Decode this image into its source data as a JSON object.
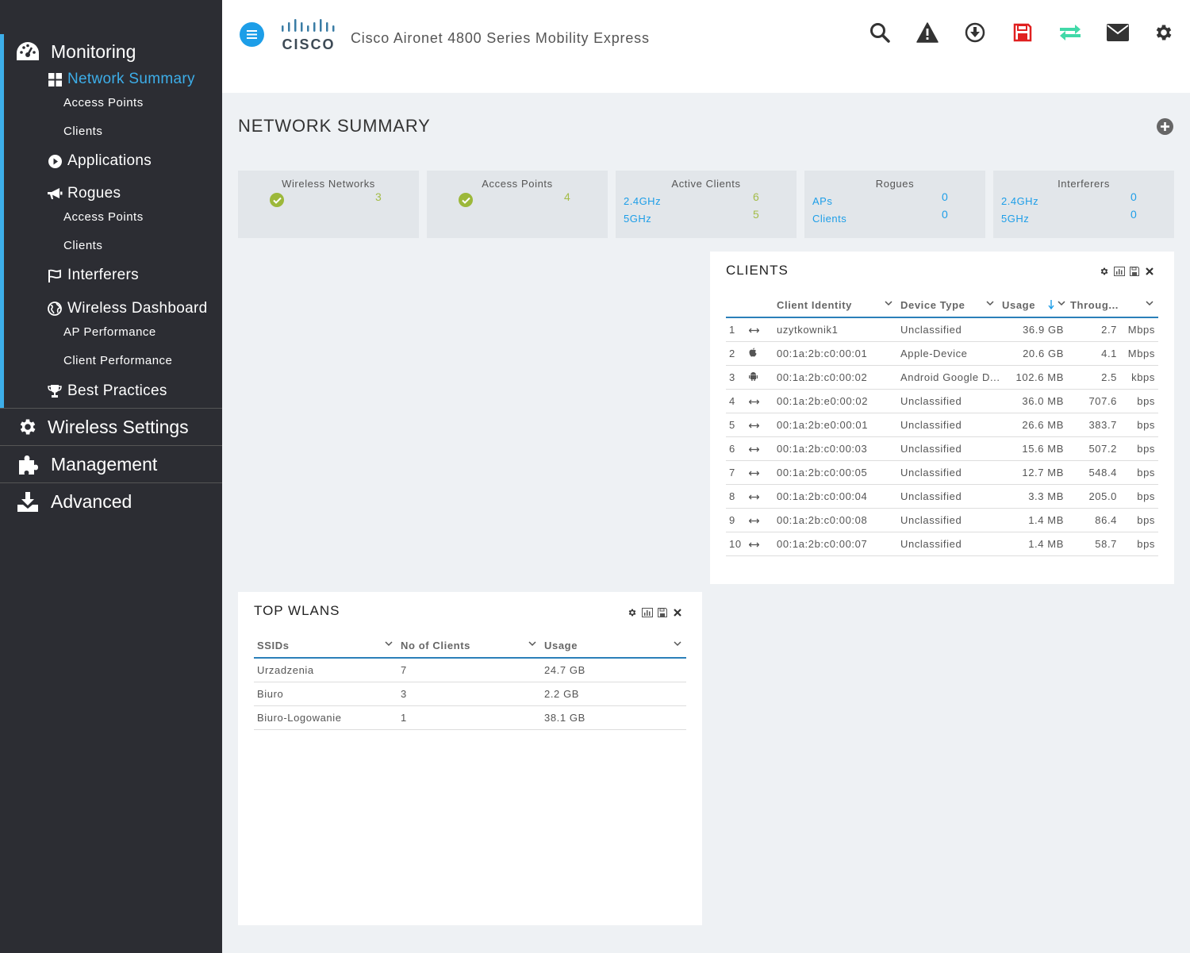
{
  "app": {
    "title": "Cisco Aironet 4800 Series Mobility Express",
    "logo_text": "CISCO"
  },
  "colors": {
    "accent_blue": "#1d9ee8",
    "sidebar_bg": "#2c2d33",
    "status_green": "#9cb83a",
    "save_red": "#e02020",
    "sync_teal": "#41d9a8"
  },
  "header_icons": [
    "search-icon",
    "warning-icon",
    "download-icon",
    "save-icon",
    "sync-icon",
    "mail-icon",
    "gear-icon"
  ],
  "sidebar": {
    "monitoring": "Monitoring",
    "network_summary": "Network Summary",
    "ns_access_points": "Access Points",
    "ns_clients": "Clients",
    "applications": "Applications",
    "rogues": "Rogues",
    "rogues_access_points": "Access Points",
    "rogues_clients": "Clients",
    "interferers": "Interferers",
    "wireless_dashboard": "Wireless Dashboard",
    "ap_performance": "AP Performance",
    "client_performance": "Client Performance",
    "best_practices": "Best Practices",
    "wireless_settings": "Wireless Settings",
    "management": "Management",
    "advanced": "Advanced"
  },
  "page": {
    "title": "NETWORK SUMMARY"
  },
  "cards": {
    "wireless_networks": {
      "title": "Wireless Networks",
      "value": "3"
    },
    "access_points": {
      "title": "Access Points",
      "value": "4"
    },
    "active_clients": {
      "title": "Active Clients",
      "band1": "2.4GHz",
      "band1_value": "6",
      "band2": "5GHz",
      "band2_value": "5"
    },
    "rogues": {
      "title": "Rogues",
      "aps_label": "APs",
      "aps_value": "0",
      "clients_label": "Clients",
      "clients_value": "0"
    },
    "interferers": {
      "title": "Interferers",
      "band1": "2.4GHz",
      "band1_value": "0",
      "band2": "5GHz",
      "band2_value": "0"
    }
  },
  "clients_panel": {
    "title": "CLIENTS",
    "columns": [
      "Client Identity",
      "Device Type",
      "Usage",
      "Throug..."
    ],
    "rows": [
      {
        "n": "1",
        "icon": "ethernet-icon",
        "identity": "uzytkownik1",
        "device": "Unclassified",
        "usage": "36.9 GB",
        "tp": "2.7",
        "unit": "Mbps"
      },
      {
        "n": "2",
        "icon": "apple-icon",
        "identity": "00:1a:2b:c0:00:01",
        "device": "Apple-Device",
        "usage": "20.6 GB",
        "tp": "4.1",
        "unit": "Mbps"
      },
      {
        "n": "3",
        "icon": "android-icon",
        "identity": "00:1a:2b:c0:00:02",
        "device": "Android Google D...",
        "usage": "102.6 MB",
        "tp": "2.5",
        "unit": "kbps"
      },
      {
        "n": "4",
        "icon": "ethernet-icon",
        "identity": "00:1a:2b:e0:00:02",
        "device": "Unclassified",
        "usage": "36.0 MB",
        "tp": "707.6",
        "unit": "bps"
      },
      {
        "n": "5",
        "icon": "ethernet-icon",
        "identity": "00:1a:2b:e0:00:01",
        "device": "Unclassified",
        "usage": "26.6 MB",
        "tp": "383.7",
        "unit": "bps"
      },
      {
        "n": "6",
        "icon": "ethernet-icon",
        "identity": "00:1a:2b:c0:00:03",
        "device": "Unclassified",
        "usage": "15.6 MB",
        "tp": "507.2",
        "unit": "bps"
      },
      {
        "n": "7",
        "icon": "ethernet-icon",
        "identity": "00:1a:2b:c0:00:05",
        "device": "Unclassified",
        "usage": "12.7 MB",
        "tp": "548.4",
        "unit": "bps"
      },
      {
        "n": "8",
        "icon": "ethernet-icon",
        "identity": "00:1a:2b:c0:00:04",
        "device": "Unclassified",
        "usage": "3.3 MB",
        "tp": "205.0",
        "unit": "bps"
      },
      {
        "n": "9",
        "icon": "ethernet-icon",
        "identity": "00:1a:2b:c0:00:08",
        "device": "Unclassified",
        "usage": "1.4 MB",
        "tp": "86.4",
        "unit": "bps"
      },
      {
        "n": "10",
        "icon": "ethernet-icon",
        "identity": "00:1a:2b:c0:00:07",
        "device": "Unclassified",
        "usage": "1.4 MB",
        "tp": "58.7",
        "unit": "bps"
      }
    ]
  },
  "wlans_panel": {
    "title": "TOP WLANS",
    "columns": [
      "SSIDs",
      "No of Clients",
      "Usage"
    ],
    "rows": [
      {
        "ssid": "Urzadzenia",
        "clients": "7",
        "usage": "24.7 GB"
      },
      {
        "ssid": "Biuro",
        "clients": "3",
        "usage": "2.2 GB"
      },
      {
        "ssid": "Biuro-Logowanie",
        "clients": "1",
        "usage": "38.1 GB"
      }
    ]
  }
}
